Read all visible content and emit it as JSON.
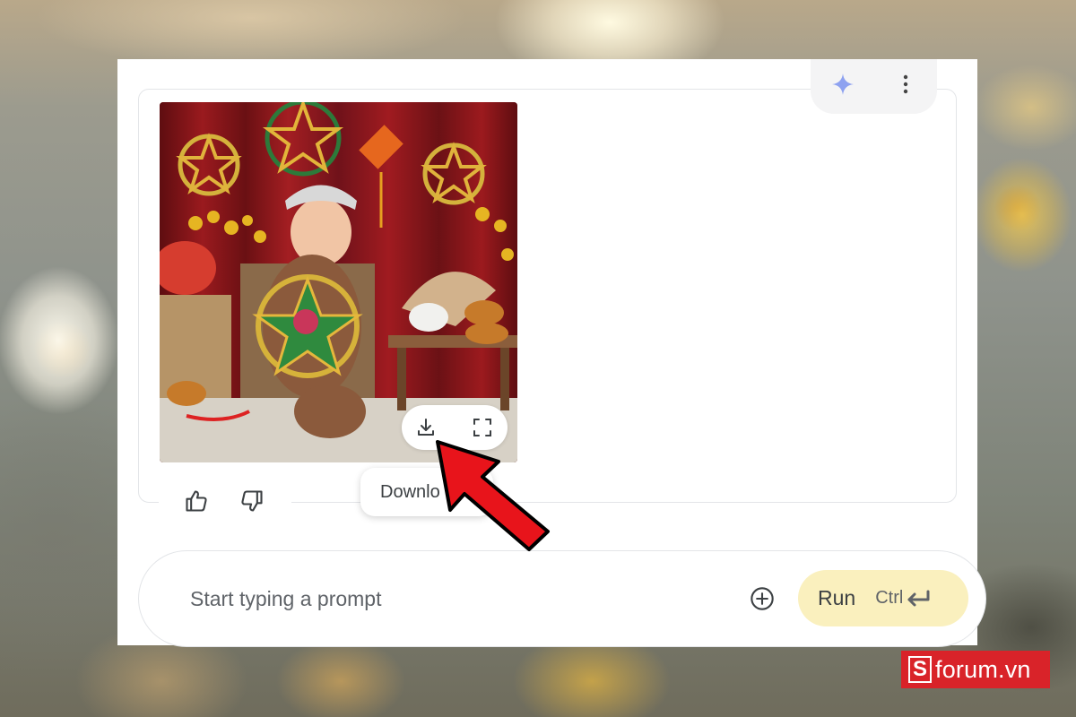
{
  "image_actions": {
    "download_tooltip": "Downlo"
  },
  "prompt": {
    "placeholder": "Start typing a prompt",
    "value": ""
  },
  "run_button": {
    "label": "Run",
    "shortcut": "Ctrl"
  },
  "watermark": {
    "letter": "S",
    "text": "forum.vn"
  },
  "icons": [
    "sparkle-icon",
    "more-vert-icon",
    "download-icon",
    "fullscreen-icon",
    "thumb-up-icon",
    "thumb-down-icon",
    "add-circle-icon",
    "enter-icon"
  ],
  "colors": {
    "run_button_bg": "#faf0be",
    "sparkle": "#8ea2f0",
    "arrow": "#e8141b",
    "logo_bg": "#d92329"
  }
}
